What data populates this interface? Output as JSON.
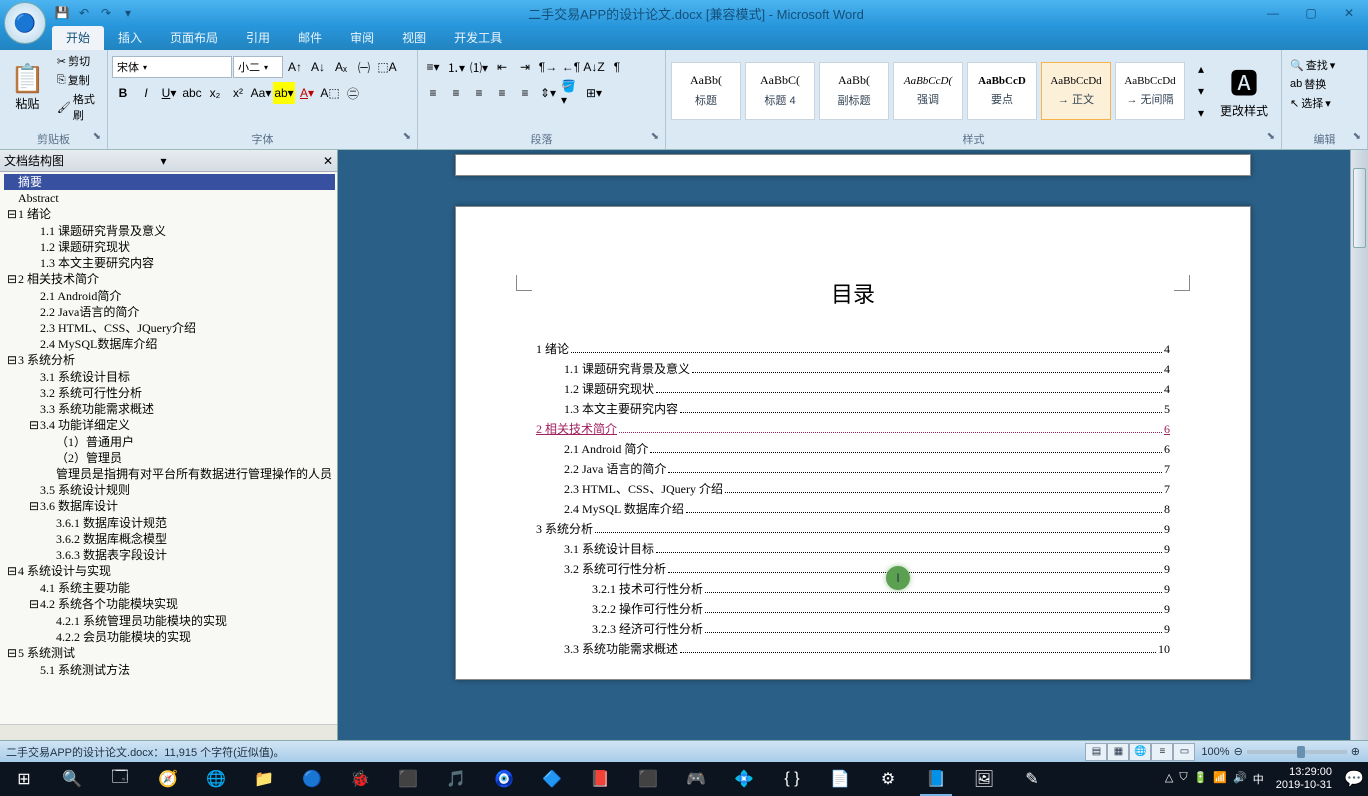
{
  "title": "二手交易APP的设计论文.docx [兼容模式] - Microsoft Word",
  "tabs": [
    "开始",
    "插入",
    "页面布局",
    "引用",
    "邮件",
    "审阅",
    "视图",
    "开发工具"
  ],
  "active_tab": "开始",
  "groups": {
    "clipboard": {
      "label": "剪贴板",
      "paste": "粘贴",
      "cut": "剪切",
      "copy": "复制",
      "format_painter": "格式刷"
    },
    "font": {
      "label": "字体",
      "family": "宋体",
      "size": "小二"
    },
    "paragraph": {
      "label": "段落"
    },
    "styles": {
      "label": "样式",
      "change": "更改样式",
      "items": [
        {
          "preview": "AaBb(",
          "name": "标题",
          "style": "font-size:12px;font-family:SimHei"
        },
        {
          "preview": "AaBbC(",
          "name": "标题 4",
          "style": "font-size:12px;font-family:SimHei"
        },
        {
          "preview": "AaBb(",
          "name": "副标题",
          "style": "font-size:12px;font-family:SimHei"
        },
        {
          "preview": "AaBbCcD(",
          "name": "强调",
          "style": "font-size:11px;font-style:italic"
        },
        {
          "preview": "AaBbCcD",
          "name": "要点",
          "style": "font-size:11px;font-weight:bold"
        },
        {
          "preview": "AaBbCcDd",
          "name": "→ 正文",
          "style": "font-size:11px",
          "selected": true
        },
        {
          "preview": "AaBbCcDd",
          "name": "→ 无间隔",
          "style": "font-size:11px"
        }
      ]
    },
    "editing": {
      "label": "编辑",
      "find": "查找",
      "replace": "替换",
      "select": "选择"
    }
  },
  "nav": {
    "title": "文档结构图",
    "items": [
      {
        "lv": 0,
        "exp": "",
        "text": "摘要",
        "sel": true
      },
      {
        "lv": 0,
        "exp": "",
        "text": "Abstract"
      },
      {
        "lv": 0,
        "exp": "⊟",
        "text": "1 绪论"
      },
      {
        "lv": 1,
        "exp": "",
        "text": "1.1 课题研究背景及意义"
      },
      {
        "lv": 1,
        "exp": "",
        "text": "1.2 课题研究现状"
      },
      {
        "lv": 1,
        "exp": "",
        "text": "1.3 本文主要研究内容"
      },
      {
        "lv": 0,
        "exp": "⊟",
        "text": "2 相关技术简介"
      },
      {
        "lv": 1,
        "exp": "",
        "text": "2.1 Android简介"
      },
      {
        "lv": 1,
        "exp": "",
        "text": "2.2 Java语言的简介"
      },
      {
        "lv": 1,
        "exp": "",
        "text": "2.3 HTML、CSS、JQuery介绍"
      },
      {
        "lv": 1,
        "exp": "",
        "text": "2.4 MySQL数据库介绍"
      },
      {
        "lv": 0,
        "exp": "⊟",
        "text": "3 系统分析"
      },
      {
        "lv": 1,
        "exp": "",
        "text": "3.1 系统设计目标"
      },
      {
        "lv": 1,
        "exp": "",
        "text": "3.2 系统可行性分析"
      },
      {
        "lv": 1,
        "exp": "",
        "text": "3.3 系统功能需求概述"
      },
      {
        "lv": 1,
        "exp": "⊟",
        "text": "3.4 功能详细定义"
      },
      {
        "lv": 2,
        "exp": "",
        "text": "（1）普通用户"
      },
      {
        "lv": 2,
        "exp": "",
        "text": "（2）管理员"
      },
      {
        "lv": 2,
        "exp": "",
        "text": "管理员是指拥有对平台所有数据进行管理操作的人员"
      },
      {
        "lv": 1,
        "exp": "",
        "text": "3.5 系统设计规则"
      },
      {
        "lv": 1,
        "exp": "⊟",
        "text": "3.6 数据库设计"
      },
      {
        "lv": 2,
        "exp": "",
        "text": "3.6.1 数据库设计规范"
      },
      {
        "lv": 2,
        "exp": "",
        "text": "3.6.2 数据库概念模型"
      },
      {
        "lv": 2,
        "exp": "",
        "text": "3.6.3 数据表字段设计"
      },
      {
        "lv": 0,
        "exp": "⊟",
        "text": "4 系统设计与实现"
      },
      {
        "lv": 1,
        "exp": "",
        "text": "4.1 系统主要功能"
      },
      {
        "lv": 1,
        "exp": "⊟",
        "text": "4.2 系统各个功能模块实现"
      },
      {
        "lv": 2,
        "exp": "",
        "text": "4.2.1 系统管理员功能模块的实现"
      },
      {
        "lv": 2,
        "exp": "",
        "text": "4.2.2 会员功能模块的实现"
      },
      {
        "lv": 0,
        "exp": "⊟",
        "text": "5 系统测试"
      },
      {
        "lv": 1,
        "exp": "",
        "text": "5.1 系统测试方法"
      }
    ]
  },
  "toc": {
    "title": "目录",
    "lines": [
      {
        "lv": 1,
        "text": "1 绪论",
        "page": "4"
      },
      {
        "lv": 2,
        "text": "1.1 课题研究背景及意义",
        "page": "4"
      },
      {
        "lv": 2,
        "text": "1.2 课题研究现状",
        "page": "4"
      },
      {
        "lv": 2,
        "text": "1.3 本文主要研究内容",
        "page": "5"
      },
      {
        "lv": 1,
        "text": "2 相关技术简介",
        "page": "6",
        "changed": true
      },
      {
        "lv": 2,
        "text": "2.1 Android 简介",
        "page": "6"
      },
      {
        "lv": 2,
        "text": "2.2 Java 语言的简介",
        "page": "7"
      },
      {
        "lv": 2,
        "text": "2.3 HTML、CSS、JQuery 介绍",
        "page": "7"
      },
      {
        "lv": 2,
        "text": "2.4 MySQL 数据库介绍",
        "page": "8"
      },
      {
        "lv": 1,
        "text": "3 系统分析",
        "page": "9"
      },
      {
        "lv": 2,
        "text": "3.1 系统设计目标",
        "page": "9"
      },
      {
        "lv": 2,
        "text": "3.2 系统可行性分析",
        "page": "9"
      },
      {
        "lv": 3,
        "text": "3.2.1 技术可行性分析",
        "page": "9"
      },
      {
        "lv": 3,
        "text": "3.2.2 操作可行性分析",
        "page": "9"
      },
      {
        "lv": 3,
        "text": "3.2.3 经济可行性分析",
        "page": "9"
      },
      {
        "lv": 2,
        "text": "3.3 系统功能需求概述",
        "page": "10"
      }
    ]
  },
  "status": "二手交易APP的设计论文.docx：11,915 个字符(近似值)。",
  "zoom": "100%",
  "taskbar": {
    "apps": [
      "⊞",
      "🔍",
      "🗔",
      "🧭",
      "🌐",
      "📁",
      "🔵",
      "🐞",
      "⬛",
      "🎵",
      "🧿",
      "🔷",
      "📕",
      "⬛",
      "🎮",
      "💠",
      "{ }",
      "📄",
      "⚙",
      "📘",
      "🖼",
      "✎"
    ],
    "tray": [
      "△",
      "⛉",
      "🔋",
      "📶",
      "🔊",
      "中"
    ]
  },
  "clock": {
    "time": "13:29:00",
    "date": "2019-10-31"
  }
}
